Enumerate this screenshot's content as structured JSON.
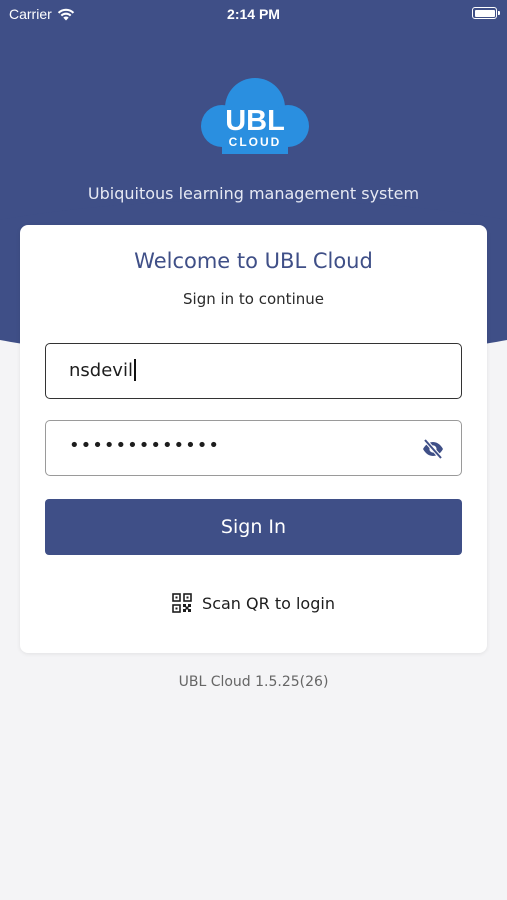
{
  "status_bar": {
    "carrier": "Carrier",
    "time": "2:14 PM",
    "battery_level": 1.0
  },
  "logo": {
    "main": "UBL",
    "sub": "CLOUD",
    "cloud_color": "#2a8fe0"
  },
  "tagline": "Ubiquitous learning management system",
  "login": {
    "title": "Welcome to UBL Cloud",
    "subtitle": "Sign in to continue",
    "username_value": "nsdevil",
    "password_mask": "•••••••••••••",
    "sign_in_label": "Sign In",
    "scan_qr_label": "Scan QR to login"
  },
  "footer": {
    "version": "UBL Cloud 1.5.25(26)"
  },
  "colors": {
    "primary": "#3f4f87",
    "background": "#f4f4f6",
    "card": "#ffffff"
  },
  "icons": {
    "wifi": "wifi-icon",
    "battery": "battery-icon",
    "eye_toggle": "eye-off-icon",
    "qr": "qr-code-icon"
  }
}
